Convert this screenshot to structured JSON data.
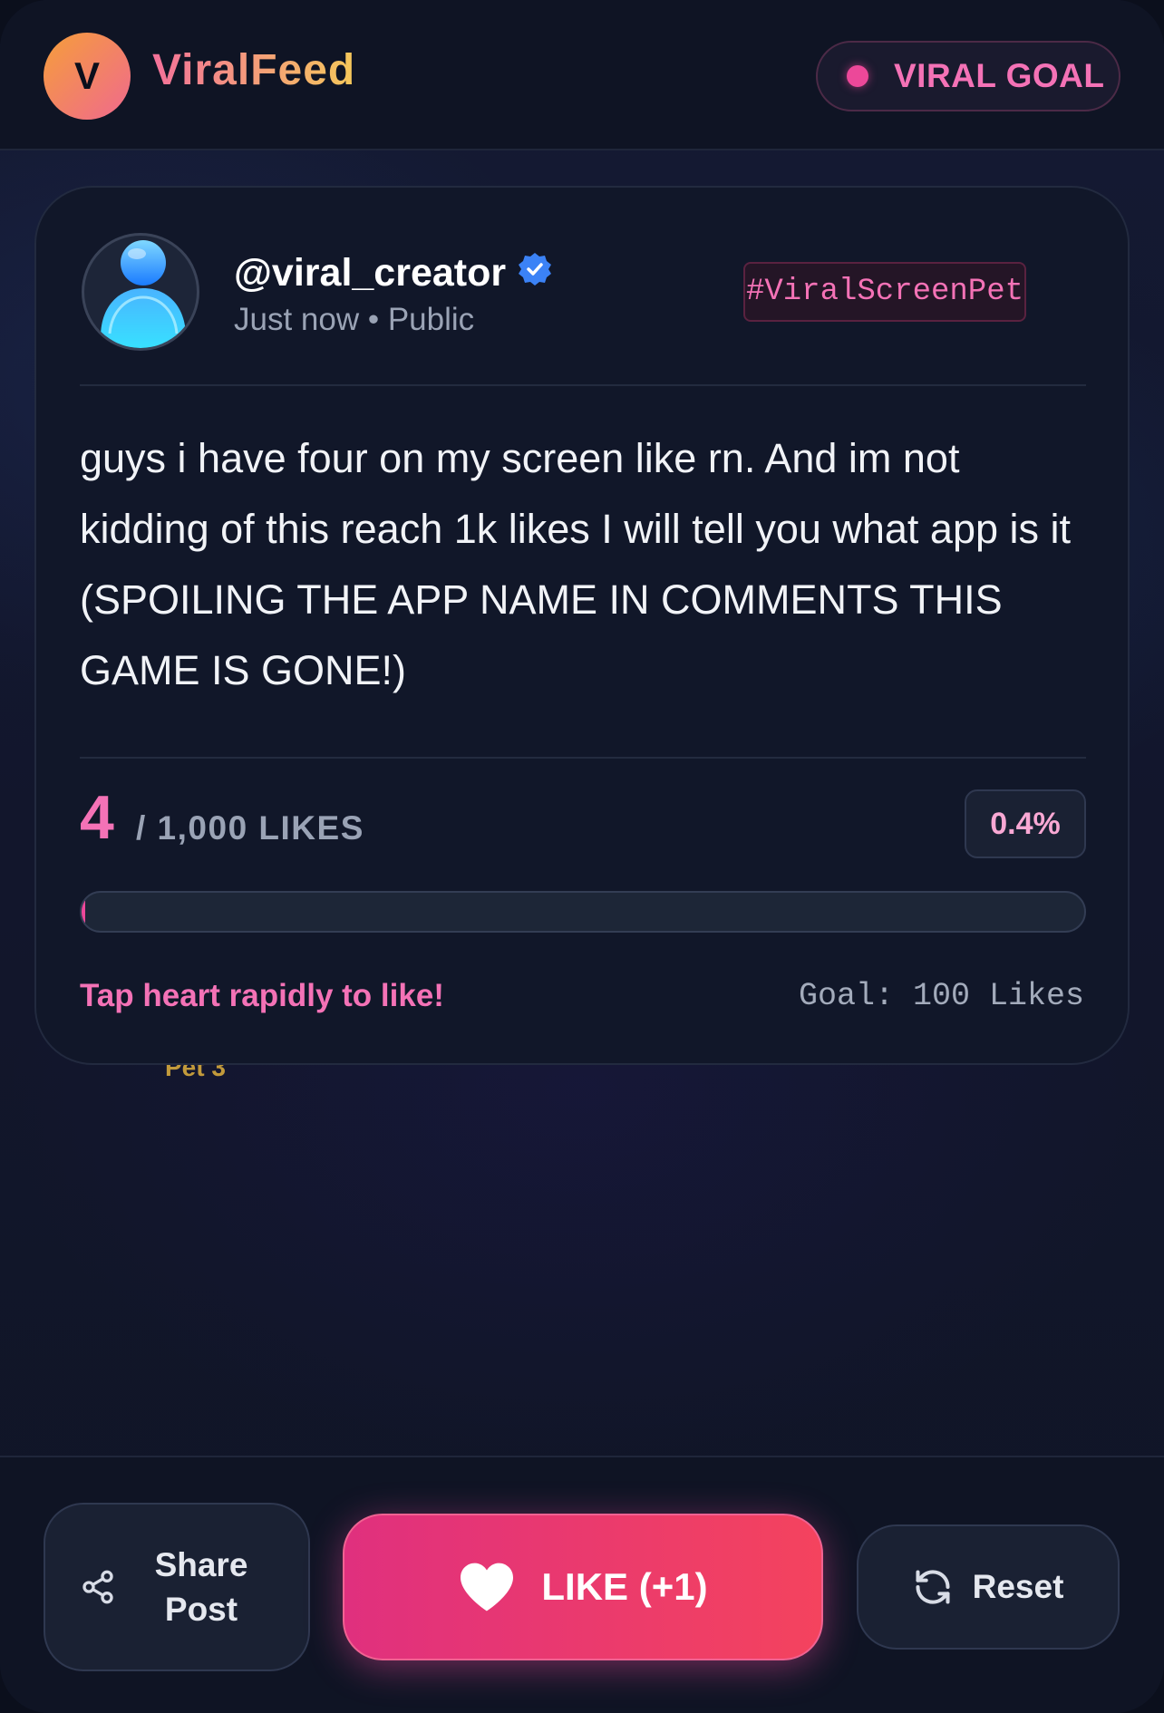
{
  "header": {
    "logo_letter": "V",
    "brand": "ViralFeed",
    "goal_badge": "VIRAL GOAL"
  },
  "post": {
    "handle": "@viral_creator",
    "meta": "Just now • Public",
    "hashtag": "#ViralScreenPet",
    "text": "guys i have four on my screen like rn. And im not kidding of this reach 1k likes I will tell you what app is it (SPOILING THE APP NAME IN COMMENTS THIS GAME IS GONE!)",
    "like_count": "4",
    "like_target_label": "/ 1,000 LIKES",
    "percent": "0.4%",
    "progress_fraction": 0.004,
    "hint": "Tap heart rapidly to like!",
    "goal_note": "Goal: 100 Likes",
    "peek_label": "Pet 3"
  },
  "actions": {
    "share_label": "Share Post",
    "like_label": "LIKE (+1)",
    "reset_label": "Reset"
  },
  "icons": {
    "share": "share-icon",
    "heart": "heart-icon",
    "reset": "refresh-icon",
    "verified": "verified-badge-icon",
    "avatar": "user-avatar-icon"
  },
  "colors": {
    "accent_pink": "#ec4899",
    "brand_orange": "#f59e3a",
    "verified_blue": "#3b82f6",
    "background": "#111729"
  }
}
